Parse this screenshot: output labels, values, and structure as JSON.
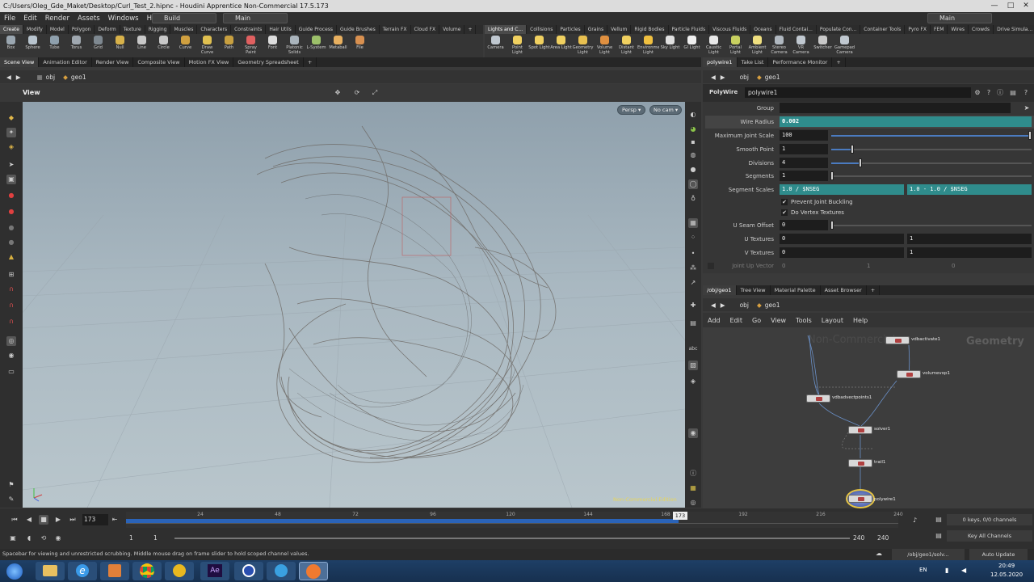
{
  "window": {
    "title": "C:/Users/Oleg_Gde_Maket/Desktop/Curl_Test_2.hipnc - Houdini Apprentice Non-Commercial 17.5.173",
    "min": "—",
    "max": "□",
    "close": "✕"
  },
  "menu": [
    "File",
    "Edit",
    "Render",
    "Assets",
    "Windows",
    "Help"
  ],
  "desktops": {
    "build": "Build",
    "main": "Main",
    "right": "Main"
  },
  "shelf_left": {
    "tabs": [
      "Create",
      "Modify",
      "Model",
      "Polygon",
      "Deform",
      "Texture",
      "Rigging",
      "Muscles",
      "Characters",
      "Constraints",
      "Hair Utils",
      "Guide Process",
      "Guide Brushes",
      "Terrain FX",
      "Cloud FX",
      "Volume"
    ],
    "tools": [
      "Box",
      "Sphere",
      "Tube",
      "Torus",
      "Grid",
      "Null",
      "Line",
      "Circle",
      "Curve",
      "Draw Curve",
      "Path",
      "Spray Paint",
      "Font",
      "Platonic Solids",
      "L-System",
      "Metaball",
      "File"
    ]
  },
  "shelf_right": {
    "tabs": [
      "Lights and C...",
      "Collisions",
      "Particles",
      "Grains",
      "Vellum",
      "Rigid Bodies",
      "Particle Fluids",
      "Viscous Fluids",
      "Oceans",
      "Fluid Contai...",
      "Populate Con...",
      "Container Tools",
      "Pyro FX",
      "FEM",
      "Wires",
      "Crowds",
      "Drive Simula..."
    ],
    "tools": [
      "Camera",
      "Point Light",
      "Spot Light",
      "Area Light",
      "Geometry Light",
      "Volume Light",
      "Distant Light",
      "Environment Light",
      "Sky Light",
      "GI Light",
      "Caustic Light",
      "Portal Light",
      "Ambient Light",
      "Stereo Camera",
      "VR Camera",
      "Switcher",
      "Gamepad Camera"
    ]
  },
  "left_tabs": [
    "Scene View",
    "Animation Editor",
    "Render View",
    "Composite View",
    "Motion FX View",
    "Geometry Spreadsheet"
  ],
  "path": {
    "obj": "obj",
    "geo": "geo1"
  },
  "viewport": {
    "title": "View",
    "persp": "Persp ▾",
    "cam": "No cam ▾",
    "watermark": "Non-Commercial Edition"
  },
  "param_tabs": [
    "polywire1",
    "Take List",
    "Performance Monitor"
  ],
  "param": {
    "node_type": "PolyWire",
    "node_name": "polywire1",
    "group_label": "Group",
    "group_value": "",
    "wire_radius_label": "Wire Radius",
    "wire_radius": "0.002",
    "max_joint_label": "Maximum Joint Scale",
    "max_joint": "100",
    "smooth_label": "Smooth Point",
    "smooth": "1",
    "div_label": "Divisions",
    "div": "4",
    "seg_label": "Segments",
    "seg": "1",
    "segscale_label": "Segment Scales",
    "segscale_a": "1.0 / $NSEG",
    "segscale_b": "1.0 - 1.0 / $NSEG",
    "prevent_label": "Prevent Joint Buckling",
    "vertex_label": "Do Vertex Textures",
    "useam_label": "U Seam Offset",
    "useam": "0",
    "utex_label": "U Textures",
    "utex_a": "0",
    "utex_b": "1",
    "vtex_label": "V Textures",
    "vtex_a": "0",
    "vtex_b": "1",
    "jointup_label": "Joint Up Vector",
    "jointup_a": "0",
    "jointup_b": "1",
    "jointup_c": "0"
  },
  "net_tabs": [
    "/obj/geo1",
    "Tree View",
    "Material Palette",
    "Asset Browser"
  ],
  "net_menu": [
    "Add",
    "Edit",
    "Go",
    "View",
    "Tools",
    "Layout",
    "Help"
  ],
  "network": {
    "context": "Geometry",
    "watermark": "Non-Commercial",
    "nodes": [
      "vdbactivate1",
      "volumevop1",
      "vdbadvectpoints1",
      "solver1",
      "trail1",
      "polywire1"
    ]
  },
  "timeline": {
    "frame": "173",
    "ticks": [
      "24",
      "48",
      "72",
      "96",
      "120",
      "144",
      "168",
      "192",
      "216",
      "240"
    ],
    "marker": "173",
    "start": "1",
    "start2": "1",
    "end": "240",
    "end2": "240",
    "keys": "0 keys, 0/0 channels",
    "keyall": "Key All Channels"
  },
  "status": {
    "hint": "Spacebar for viewing and unrestricted scrubbing. Middle mouse drag on frame slider to hold scoped channel values.",
    "path": "/obj/geo1/solv...",
    "update": "Auto Update"
  },
  "taskbar": {
    "lang": "EN",
    "time": "20:49",
    "date": "12.05.2020"
  }
}
